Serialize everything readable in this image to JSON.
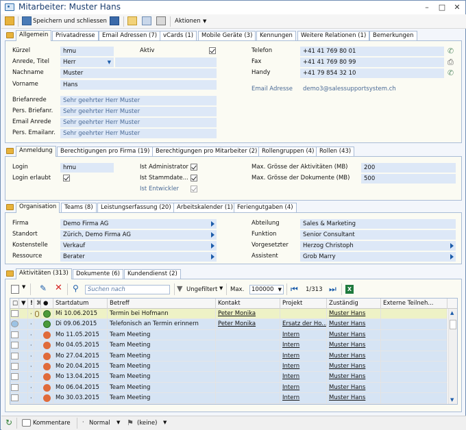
{
  "window": {
    "title": "Mitarbeiter: Muster Hans"
  },
  "toolbar": {
    "save_close": "Speichern und schliessen",
    "actions": "Aktionen"
  },
  "tabs1": [
    "Allgemein",
    "Privatadresse",
    "Email Adressen (7)",
    "vCards (1)",
    "Mobile Geräte (3)",
    "Kennungen",
    "Weitere Relationen (1)",
    "Bemerkungen"
  ],
  "general": {
    "kuerzel_label": "Kürzel",
    "kuerzel": "hmu",
    "aktiv_label": "Aktiv",
    "anrede_label": "Anrede, Titel",
    "anrede": "Herr",
    "nachname_label": "Nachname",
    "nachname": "Muster",
    "vorname_label": "Vorname",
    "vorname": "Hans",
    "briefanrede_label": "Briefanrede",
    "briefanrede": "Sehr geehrter Herr Muster",
    "pers_briefanr_label": "Pers. Briefanr.",
    "pers_briefanr": "Sehr geehrter Herr Muster",
    "email_anrede_label": "Email Anrede",
    "email_anrede": "Sehr geehrter Herr Muster",
    "pers_emailanr_label": "Pers. Emailanr.",
    "pers_emailanr": "Sehr geehrter Herr Muster",
    "telefon_label": "Telefon",
    "telefon": "+41 41 769 80 01",
    "fax_label": "Fax",
    "fax": "+41 41 769 80 99",
    "handy_label": "Handy",
    "handy": "+41 79 854 32 10",
    "email_label": "Email Adresse",
    "email": "demo3@salessupportsystem.ch"
  },
  "tabs2": [
    "Anmeldung",
    "Berechtigungen pro Firma (19)",
    "Berechtigungen pro Mitarbeiter (2)",
    "Rollengruppen (4)",
    "Rollen (43)"
  ],
  "login": {
    "login_label": "Login",
    "login": "hmu",
    "login_erlaubt_label": "Login erlaubt",
    "ist_admin_label": "Ist Administrator",
    "ist_stammdaten_label": "Ist  Stammdate...",
    "ist_entwickler_label": "Ist Entwickler",
    "max_akt_label": "Max. Grösse der Aktivitäten (MB)",
    "max_akt": "200",
    "max_dok_label": "Max. Grösse der Dokumente (MB)",
    "max_dok": "500"
  },
  "tabs3": [
    "Organisation",
    "Teams (8)",
    "Leistungserfassung (20)",
    "Arbeitskalender (1)",
    "Feriengutgaben (4)"
  ],
  "org": {
    "firma_label": "Firma",
    "firma": "Demo Firma AG",
    "standort_label": "Standort",
    "standort": "Zürich, Demo Firma AG",
    "kostenstelle_label": "Kostenstelle",
    "kostenstelle": "Verkauf",
    "ressource_label": "Ressource",
    "ressource": "Berater",
    "abteilung_label": "Abteilung",
    "abteilung": "Sales & Marketing",
    "funktion_label": "Funktion",
    "funktion": "Senior Consultant",
    "vorgesetzter_label": "Vorgesetzter",
    "vorgesetzter": "Herzog Christoph",
    "assistent_label": "Assistent",
    "assistent": "Grob Marry"
  },
  "tabs4": [
    "Aktivitäten (313)",
    "Dokumente (6)",
    "Kundendienst (2)"
  ],
  "gridtoolbar": {
    "search_placeholder": "Suchen nach",
    "filter": "Ungefiltert",
    "max_label": "Max.",
    "max_value": "100000",
    "page": "1/313"
  },
  "grid": {
    "headers": [
      "Startdatum",
      "Betreff",
      "Kontakt",
      "Projekt",
      "Zuständig",
      "Externe Teilneh..."
    ],
    "rows": [
      {
        "date": "Mi 10.06.2015",
        "subject": "Termin bei Hofmann",
        "contact": "Peter Monika",
        "project": "",
        "owner": "Muster Hans",
        "hl": true
      },
      {
        "date": "Di 09.06.2015",
        "subject": "Telefonisch an Termin erinnern",
        "contact": "Peter Monika",
        "project": "Ersatz der Ho...",
        "owner": "Muster Hans",
        "hl": false
      },
      {
        "date": "Mo 11.05.2015",
        "subject": "Team Meeting",
        "contact": "",
        "project": "Intern",
        "owner": "Muster Hans",
        "hl": false
      },
      {
        "date": "Mo 04.05.2015",
        "subject": "Team Meeting",
        "contact": "",
        "project": "Intern",
        "owner": "Muster Hans",
        "hl": false
      },
      {
        "date": "Mo 27.04.2015",
        "subject": "Team Meeting",
        "contact": "",
        "project": "Intern",
        "owner": "Muster Hans",
        "hl": false
      },
      {
        "date": "Mo 20.04.2015",
        "subject": "Team Meeting",
        "contact": "",
        "project": "Intern",
        "owner": "Muster Hans",
        "hl": false
      },
      {
        "date": "Mo 13.04.2015",
        "subject": "Team Meeting",
        "contact": "",
        "project": "Intern",
        "owner": "Muster Hans",
        "hl": false
      },
      {
        "date": "Mo 06.04.2015",
        "subject": "Team Meeting",
        "contact": "",
        "project": "Intern",
        "owner": "Muster Hans",
        "hl": false
      },
      {
        "date": "Mo 30.03.2015",
        "subject": "Team Meeting",
        "contact": "",
        "project": "Intern",
        "owner": "Muster Hans",
        "hl": false
      }
    ]
  },
  "status": {
    "comments": "Kommentare",
    "priority": "Normal",
    "flag": "(keine)"
  }
}
